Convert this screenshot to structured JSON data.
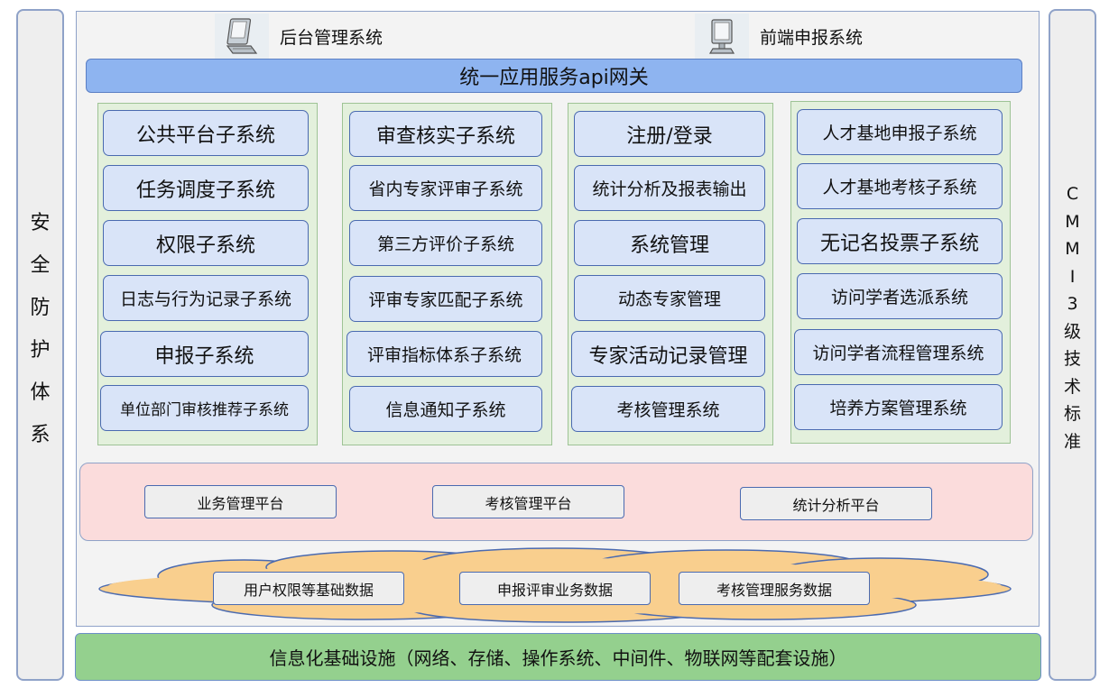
{
  "left_panel": {
    "title": "安全防护体系",
    "chars": [
      "安",
      "全",
      "防",
      "护",
      "体",
      "系"
    ]
  },
  "right_panel": {
    "title": "CMMI3级技术标准",
    "chars": [
      "C",
      "M",
      "M",
      "I",
      "3",
      "级",
      "技",
      "术",
      "标",
      "准"
    ]
  },
  "clients": {
    "backend": "后台管理系统",
    "frontend": "前端申报系统"
  },
  "gateway": "统一应用服务api网关",
  "columns": [
    {
      "items": [
        "公共平台子系统",
        "任务调度子系统",
        "权限子系统",
        "日志与行为记录子系统",
        "申报子系统",
        "单位部门审核推荐子系统"
      ]
    },
    {
      "items": [
        "审查核实子系统",
        "省内专家评审子系统",
        "第三方评价子系统",
        "评审专家匹配子系统",
        "评审指标体系子系统",
        "信息通知子系统"
      ]
    },
    {
      "items": [
        "注册/登录",
        "统计分析及报表输出",
        "系统管理",
        "动态专家管理",
        "专家活动记录管理",
        "考核管理系统"
      ]
    },
    {
      "items": [
        "人才基地申报子系统",
        "人才基地考核子系统",
        "无记名投票子系统",
        "访问学者选派系统",
        "访问学者流程管理系统",
        "培养方案管理系统"
      ]
    }
  ],
  "platforms": [
    "业务管理平台",
    "考核管理平台",
    "统计分析平台"
  ],
  "data_layer": [
    "用户权限等基础数据",
    "申报评审业务数据",
    "考核管理服务数据"
  ],
  "infrastructure": "信息化基础设施（网络、存储、操作系统、中间件、物联网等配套设施）",
  "colors": {
    "gateway": "#8eb4f0",
    "column_bg": "#e3f0dc",
    "subsystem_bg": "#d9e4f8",
    "subsystem_border": "#4a6ab0",
    "platform_bg": "#fbdcdc",
    "cloud": "#f9cf8e",
    "infrastructure": "#94d08e",
    "side_bg": "#eeeeee"
  },
  "icons": {
    "backend": "computer-icon",
    "frontend": "monitor-icon"
  }
}
